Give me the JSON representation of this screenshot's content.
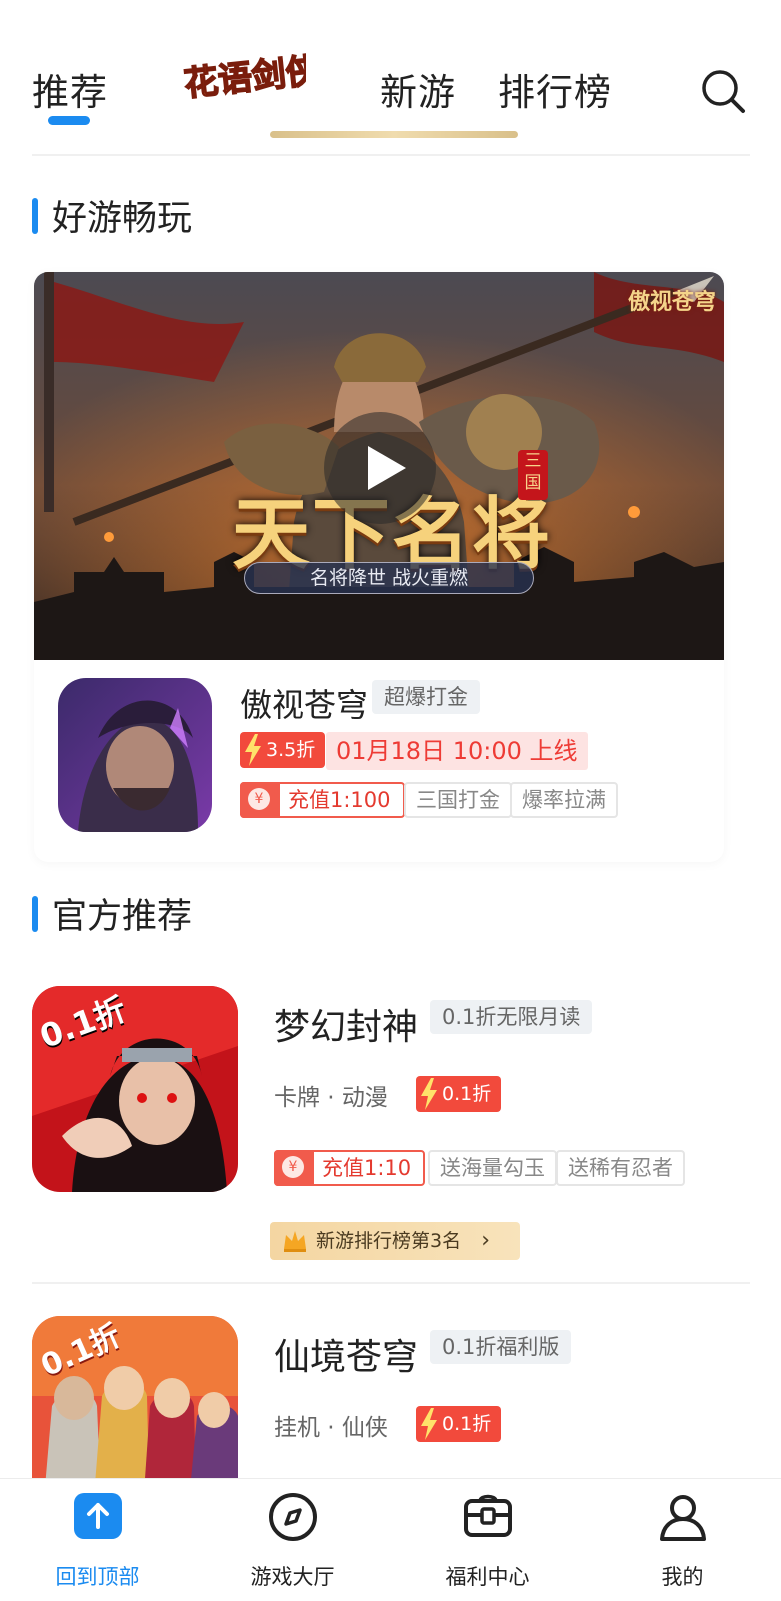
{
  "header": {
    "tabs": [
      "推荐",
      "新游",
      "排行榜"
    ],
    "logo_text": "花语剑侠"
  },
  "sections": {
    "featured_title": "好游畅玩",
    "official_title": "官方推荐"
  },
  "featured": {
    "banner_brand": "傲视苍穹",
    "banner_title": "天下名将",
    "banner_badge": "三国",
    "banner_slogan": "名将降世 战火重燃",
    "name": "傲视苍穹",
    "label": "超爆打金",
    "discount": "3.5折",
    "launch": "01月18日 10:00 上线",
    "recharge": "充值1:100",
    "tags": [
      "三国打金",
      "爆率拉满"
    ]
  },
  "games": [
    {
      "name": "梦幻封神",
      "label": "0.1折无限月读",
      "icon_badge": "0.1折",
      "genre": "卡牌 · 动漫",
      "discount": "0.1折",
      "recharge": "充值1:10",
      "tags": [
        "送海量勾玉",
        "送稀有忍者"
      ],
      "rank": "新游排行榜第3名"
    },
    {
      "name": "仙境苍穹",
      "label": "0.1折福利版",
      "icon_badge": "0.1折",
      "genre": "挂机 · 仙侠",
      "discount": "0.1折"
    }
  ],
  "bottom_nav": [
    {
      "label": "回到顶部",
      "icon": "arrow-up-icon",
      "active": true
    },
    {
      "label": "游戏大厅",
      "icon": "compass-icon",
      "active": false
    },
    {
      "label": "福利中心",
      "icon": "gift-box-icon",
      "active": false
    },
    {
      "label": "我的",
      "icon": "user-icon",
      "active": false
    }
  ],
  "colors": {
    "accent": "#1b8bf0",
    "discount": "#f24a3c",
    "launch_text": "#ee3b35",
    "launch_bg": "#fde3e2"
  }
}
